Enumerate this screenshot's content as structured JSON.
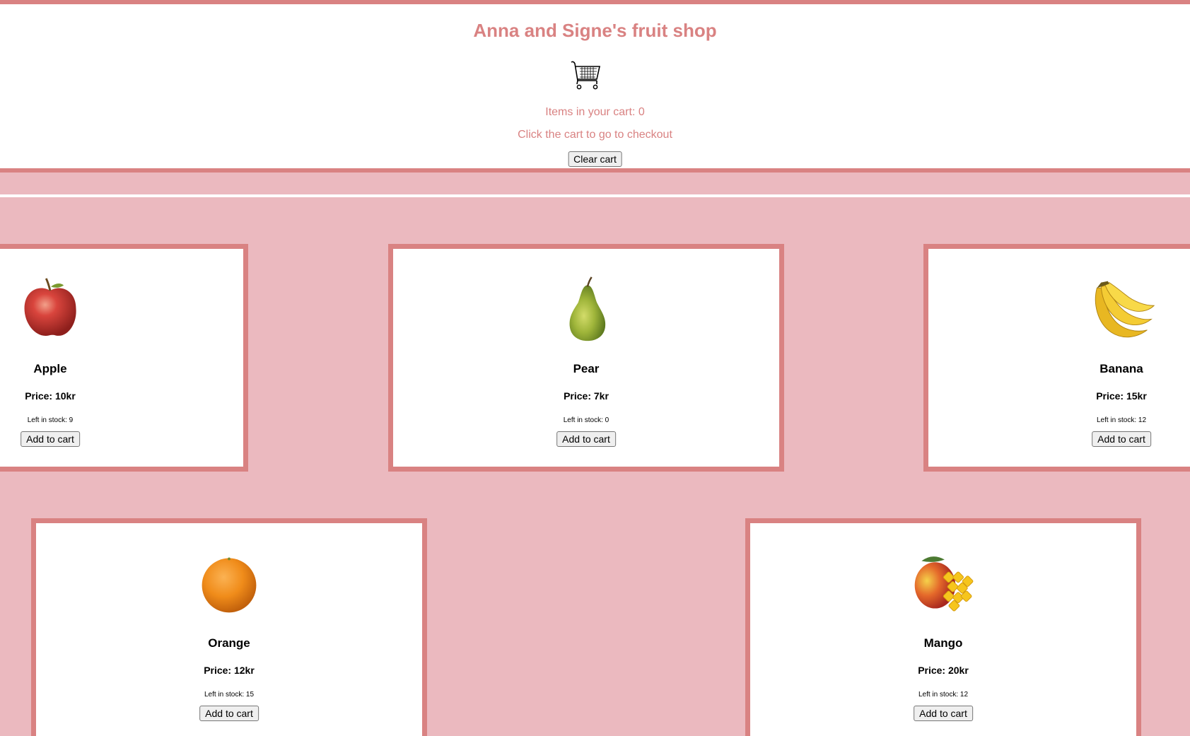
{
  "header": {
    "title": "Anna and Signe's fruit shop",
    "cart_icon": "shopping-cart-icon",
    "cart_count_text": "Items in your cart: 0",
    "checkout_hint": "Click the cart to go to checkout",
    "clear_cart_label": "Clear cart"
  },
  "colors": {
    "accent": "#d98282",
    "background": "#ebb9bf",
    "card": "#ffffff"
  },
  "products": [
    {
      "name": "Apple",
      "price": "Price: 10kr",
      "stock": "Left in stock: 9",
      "button": "Add to cart",
      "icon": "apple-icon"
    },
    {
      "name": "Pear",
      "price": "Price: 7kr",
      "stock": "Left in stock: 0",
      "button": "Add to cart",
      "icon": "pear-icon"
    },
    {
      "name": "Banana",
      "price": "Price: 15kr",
      "stock": "Left in stock: 12",
      "button": "Add to cart",
      "icon": "banana-icon"
    },
    {
      "name": "Orange",
      "price": "Price: 12kr",
      "stock": "Left in stock: 15",
      "button": "Add to cart",
      "icon": "orange-icon"
    },
    {
      "name": "Mango",
      "price": "Price: 20kr",
      "stock": "Left in stock: 12",
      "button": "Add to cart",
      "icon": "mango-icon"
    }
  ]
}
